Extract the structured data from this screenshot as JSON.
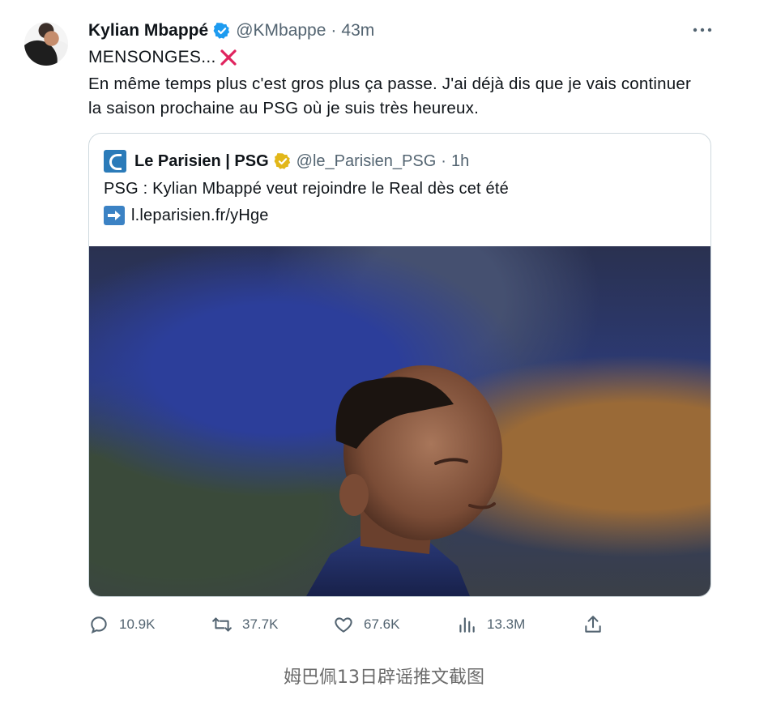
{
  "tweet": {
    "author_name": "Kylian Mbappé",
    "author_handle": "@KMbappe",
    "separator": "·",
    "time": "43m",
    "line1": "MENSONGES...",
    "line2": "En même temps plus c'est gros plus ça passe. J'ai déjà dis que je vais continuer la saison prochaine au PSG où je suis très heureux."
  },
  "quote": {
    "name": "Le Parisien | PSG",
    "handle": "@le_Parisien_PSG",
    "separator": "·",
    "time": "1h",
    "text": "PSG : Kylian Mbappé veut rejoindre le Real dès cet été",
    "link": "l.leparisien.fr/yHge"
  },
  "actions": {
    "replies": "10.9K",
    "retweets": "37.7K",
    "likes": "67.6K",
    "views": "13.3M"
  },
  "caption": "姆巴佩13日辟谣推文截图",
  "colors": {
    "verified": "#1d9bf0",
    "gold_badge": "#e2b719",
    "x_mark": "#e0245e",
    "muted": "#536471"
  },
  "icons": [
    "verified-badge-icon",
    "more-icon",
    "cross-mark-icon",
    "le-parisien-logo-icon",
    "gold-badge-icon",
    "right-arrow-icon",
    "reply-icon",
    "retweet-icon",
    "like-icon",
    "views-icon",
    "share-icon"
  ]
}
